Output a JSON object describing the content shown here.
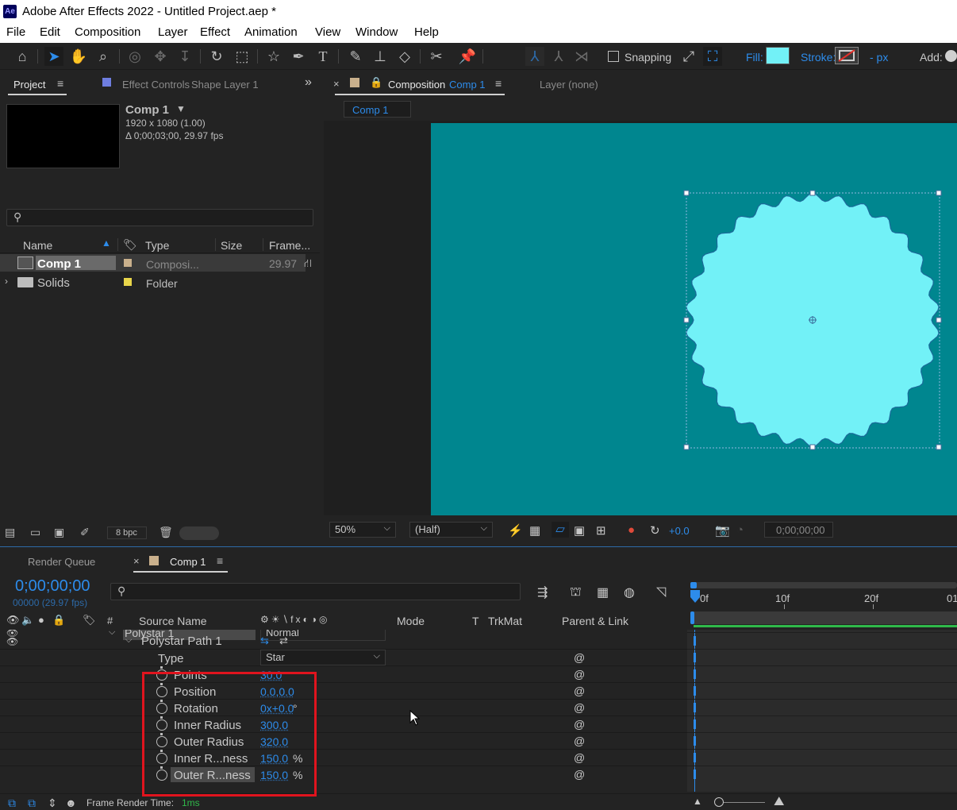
{
  "app": {
    "logo_text": "Ae",
    "window_title": "Adobe After Effects 2022 - Untitled Project.aep *"
  },
  "menu": [
    "File",
    "Edit",
    "Composition",
    "Layer",
    "Effect",
    "Animation",
    "View",
    "Window",
    "Help"
  ],
  "toolbar": {
    "snapping_label": "Snapping",
    "fill_label": "Fill:",
    "fill_color": "#72f1f7",
    "stroke_label": "Stroke:",
    "stroke_width": "- px",
    "add_label": "Add:"
  },
  "project_panel": {
    "tab_project": "Project",
    "tab_effect_controls": "Effect Controls",
    "tab_effect_controls_target": "Shape Layer 1",
    "comp_name": "Comp 1",
    "comp_size": "1920 x 1080 (1.00)",
    "comp_duration": "Δ 0;00;03;00, 29.97 fps",
    "columns": [
      "Name",
      "Type",
      "Size",
      "Frame..."
    ],
    "items": [
      {
        "name": "Comp 1",
        "label_color": "#c9b08c",
        "type": "Composi...",
        "size": "",
        "frame": "29.97"
      },
      {
        "name": "Solids",
        "label_color": "#e8d54a",
        "type": "Folder",
        "size": "",
        "frame": ""
      }
    ],
    "bpc": "8 bpc"
  },
  "comp_panel": {
    "tab_prefix": "Composition",
    "tab_comp": "Comp 1",
    "tab_layer": "Layer (none)",
    "sub_tab": "Comp 1",
    "bg_color": "#00868f",
    "shape_fill": "#72f1f7",
    "zoom": "50%",
    "resolution": "(Half)",
    "exposure": "+0.0",
    "timecode": "0;00;00;00"
  },
  "timeline": {
    "tab_render_queue": "Render Queue",
    "tab_comp": "Comp 1",
    "timecode": "0;00;00;00",
    "frames": "00000 (29.97 fps)",
    "col_source_name": "Source Name",
    "col_mode": "Mode",
    "col_t": "T",
    "col_trkmat": "TrkMat",
    "col_parent": "Parent & Link",
    "hash": "#",
    "ruler": [
      "0f",
      "10f",
      "20f",
      "01"
    ],
    "layer_partial": "Polystar 1",
    "layer_partial_mode": "Normal",
    "path_name": "Polystar Path 1",
    "type_label": "Type",
    "type_value": "Star",
    "properties": [
      {
        "label": "Points",
        "value": "30.0",
        "unit": ""
      },
      {
        "label": "Position",
        "value": "0.0,0.0",
        "unit": ""
      },
      {
        "label": "Rotation",
        "value": "0x+0.0",
        "unit": "°"
      },
      {
        "label": "Inner Radius",
        "value": "300.0",
        "unit": ""
      },
      {
        "label": "Outer Radius",
        "value": "320.0",
        "unit": ""
      },
      {
        "label": "Inner R...ness",
        "value": "150.0",
        "unit": "%"
      },
      {
        "label": "Outer R...ness",
        "value": "150.0",
        "unit": "%"
      }
    ],
    "render_time_label": "Frame Render Time:",
    "render_time_value": "1ms"
  }
}
